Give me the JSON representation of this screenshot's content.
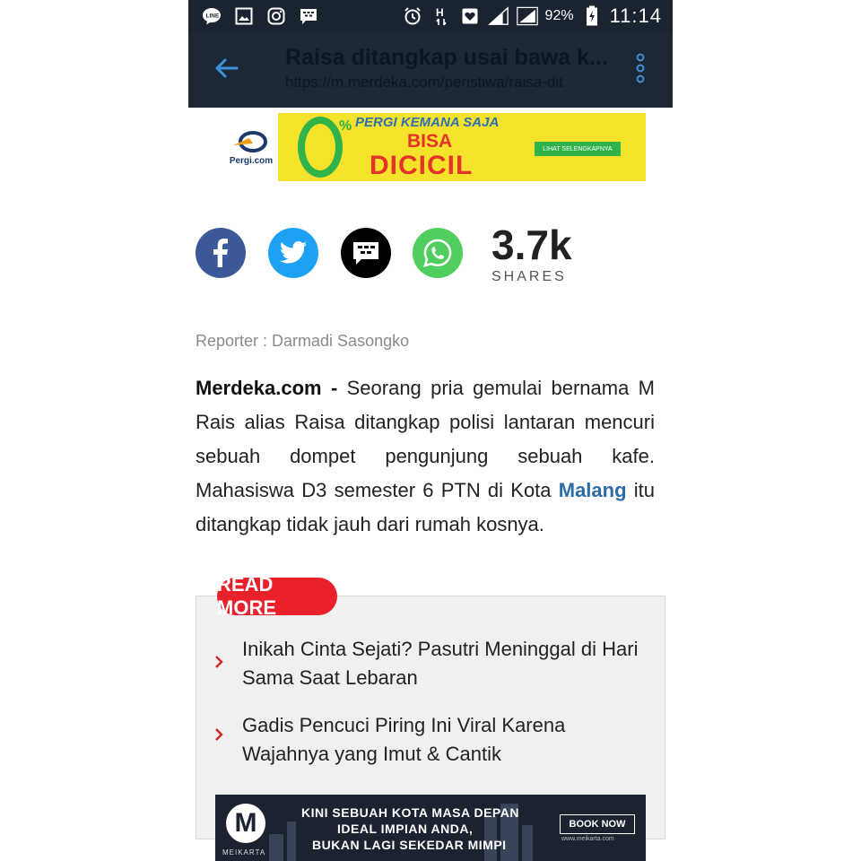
{
  "status_bar": {
    "icons": [
      "line-icon",
      "gallery-icon",
      "instagram-icon",
      "bbm-icon",
      "alarm-icon",
      "network-h-icon",
      "heart-icon",
      "signal-icon",
      "signal-icon",
      "battery-icon"
    ],
    "network_label": "H",
    "battery_percent": "92%",
    "time": "11:14"
  },
  "toolbar": {
    "title": "Raisa ditangkap usai bawa k...",
    "url": "https://m.merdeka.com/peristiwa/raisa-dit"
  },
  "ad_top": {
    "brand": "Pergi.com",
    "zero_percent": "%",
    "line1": "PERGI KEMANA SAJA",
    "line2": "BISA",
    "line3": "DICICIL",
    "cta": "LIHAT SELENGKAPNYA"
  },
  "share": {
    "buttons": [
      "facebook-icon",
      "twitter-icon",
      "bbm-icon",
      "whatsapp-icon"
    ],
    "count": "3.7k",
    "label": "SHARES"
  },
  "article": {
    "reporter": "Reporter : Darmadi Sasongko",
    "source": "Merdeka.com -",
    "body_before_link": " Seorang pria gemulai bernama M Rais alias Raisa ditangkap polisi lantaran mencuri sebuah dompet pengunjung sebuah kafe. Mahasiswa D3 semester 6 PTN di Kota ",
    "link_text": "Malang",
    "body_after_link": " itu ditangkap tidak jauh dari rumah kosnya."
  },
  "read_more": {
    "badge": "READ MORE",
    "items": [
      {
        "title": "Inikah Cinta Sejati? Pasutri Meninggal di Hari Sama Saat Lebaran"
      },
      {
        "title": "Gadis Pencuci Piring Ini Viral Karena Wajahnya yang Imut & Cantik"
      }
    ]
  },
  "ad_bottom": {
    "logo_letter": "M",
    "logo_text": "MEIKARTA",
    "line1": "KINI SEBUAH KOTA MASA DEPAN",
    "line2": "IDEAL IMPIAN ANDA,",
    "line3": "BUKAN LAGI SEKEDAR MIMPI",
    "cta": "BOOK NOW",
    "site": "www.meikarta.com"
  },
  "colors": {
    "toolbar": "#1c2836",
    "back_arrow": "#3d8fe0",
    "facebook": "#3b5998",
    "twitter": "#1da1f2",
    "bbm": "#000000",
    "whatsapp": "#4fce5d",
    "link": "#2b6ca3",
    "read_more_badge": "#e8212a"
  }
}
